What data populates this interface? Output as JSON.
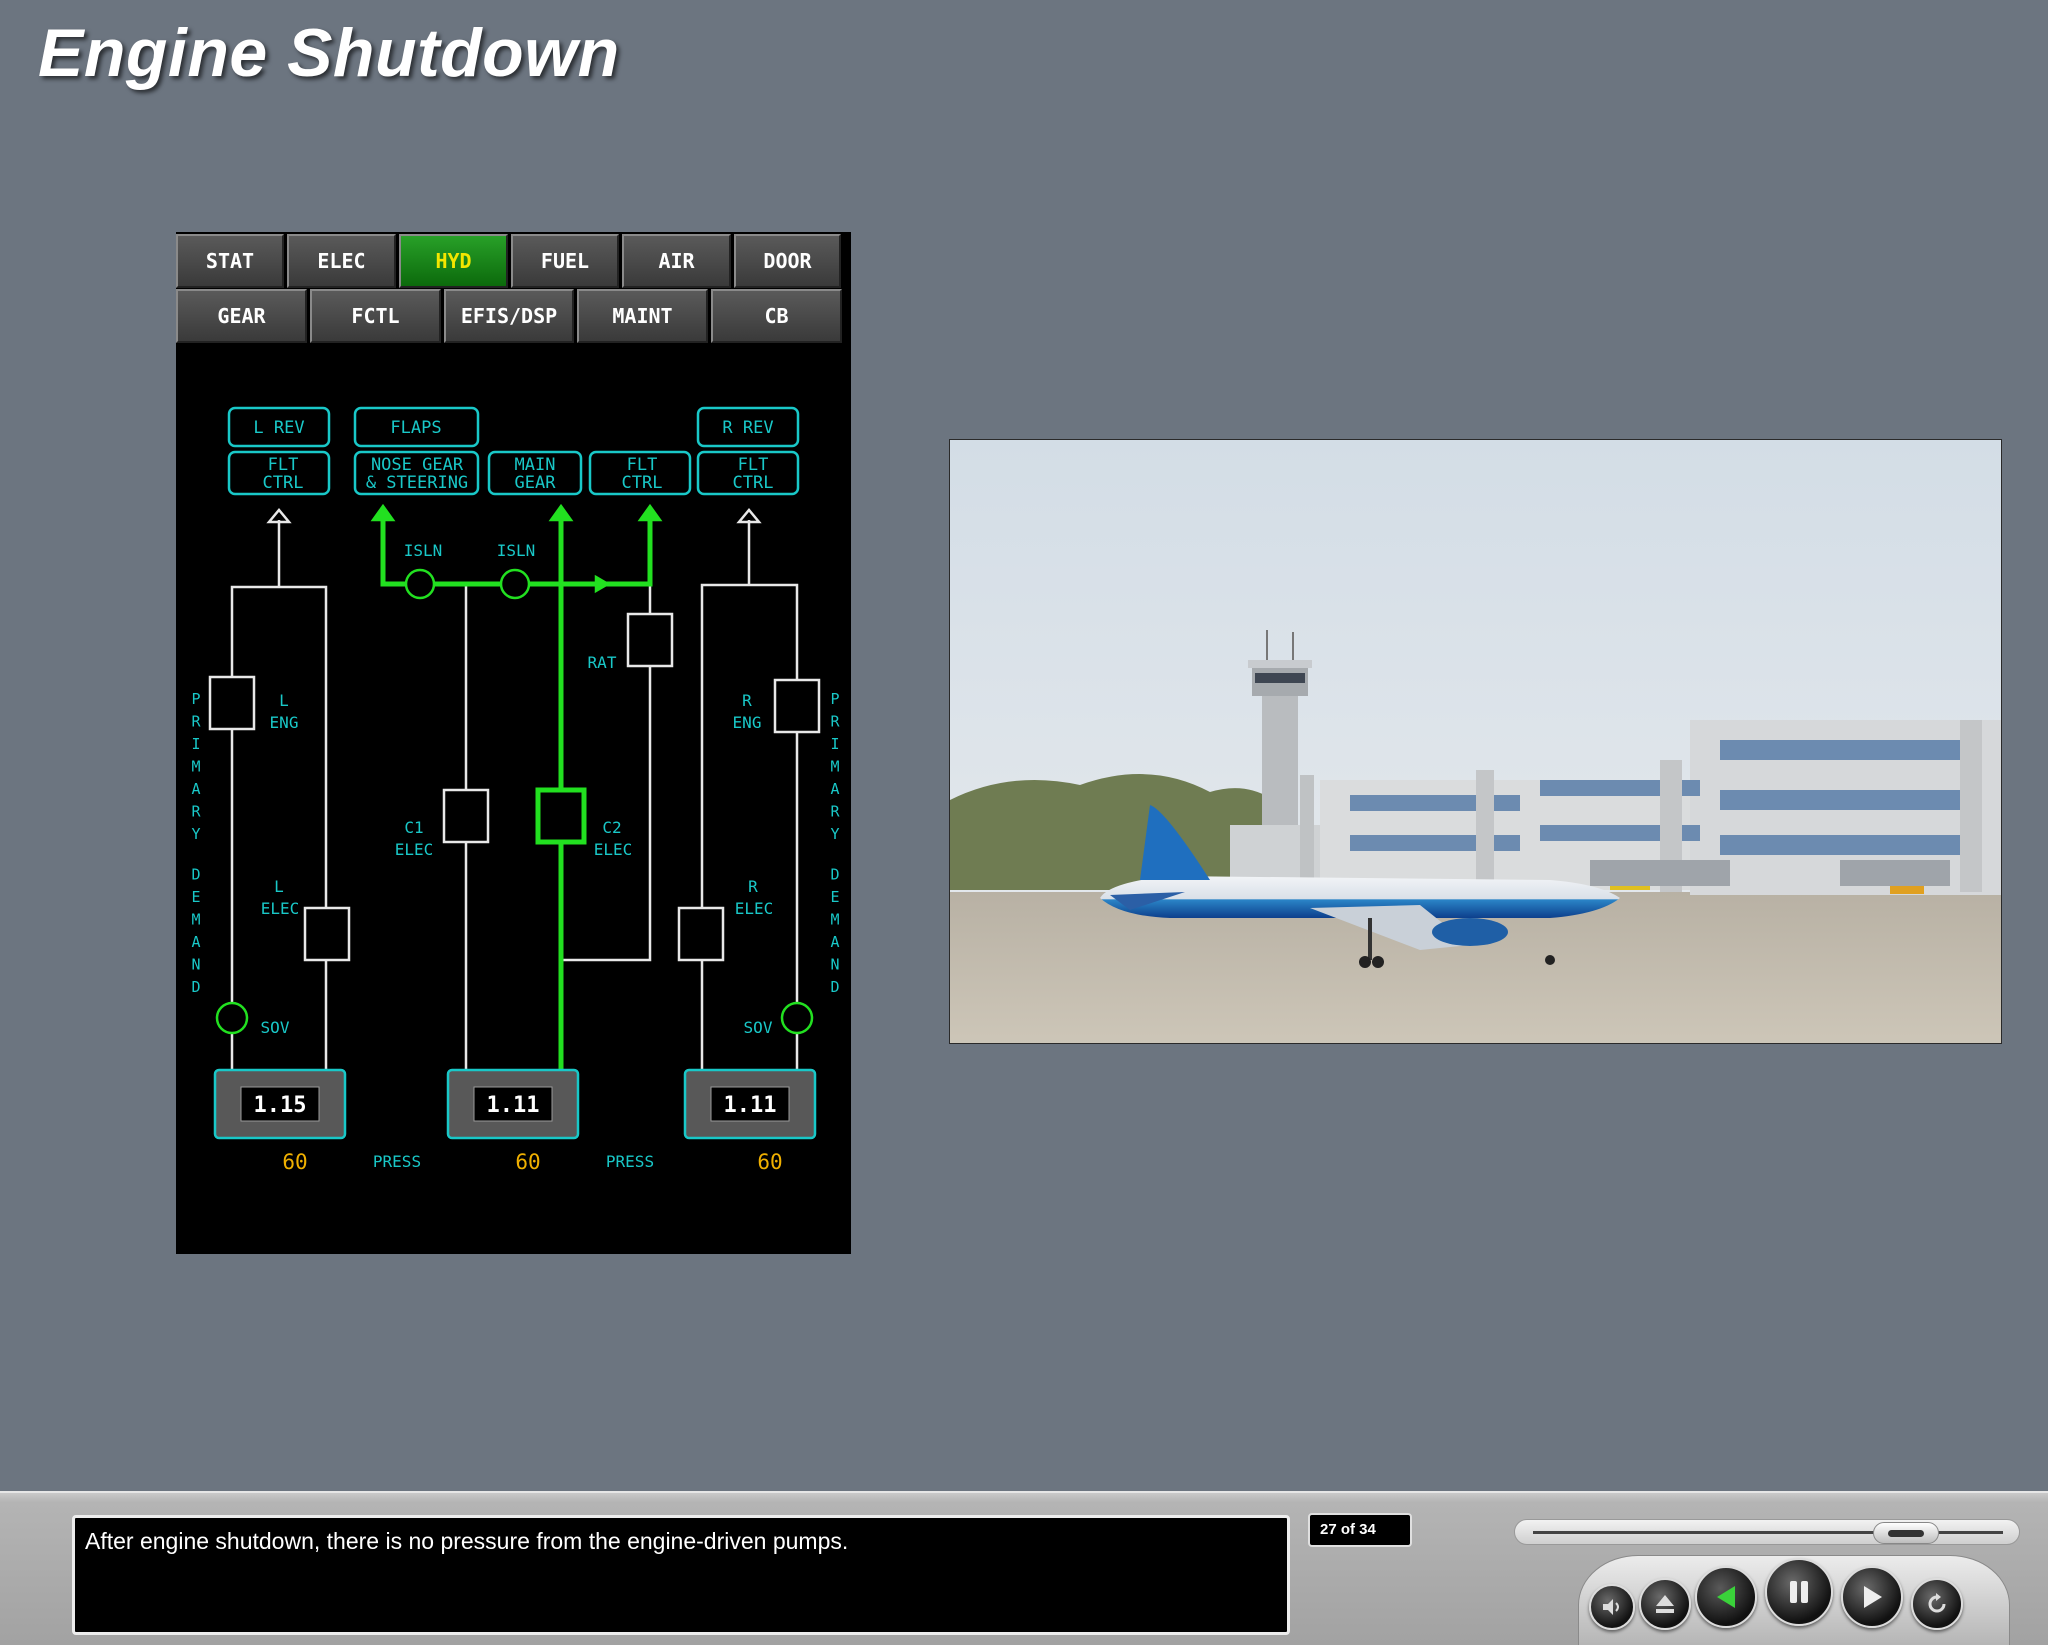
{
  "slide": {
    "title": "Engine Shutdown"
  },
  "synoptic": {
    "tabs_row1": [
      "STAT",
      "ELEC",
      "HYD",
      "FUEL",
      "AIR",
      "DOOR"
    ],
    "tabs_row2": [
      "GEAR",
      "FCTL",
      "EFIS/DSP",
      "MAINT",
      "CB"
    ],
    "active_tab": "HYD",
    "labels": {
      "l_rev": "L REV",
      "flaps": "FLAPS",
      "r_rev": "R REV",
      "flt": "FLT",
      "ctrl": "CTRL",
      "nose_gear": "NOSE GEAR",
      "steering": "& STEERING",
      "main": "MAIN",
      "gear": "GEAR",
      "isln": "ISLN",
      "rat": "RAT",
      "l": "L",
      "r": "R",
      "eng": "ENG",
      "elec": "ELEC",
      "c1": "C1",
      "c2": "C2",
      "sov": "SOV",
      "press": "PRESS",
      "primary": "PRIMARY",
      "demand": "DEMAND"
    },
    "systems": [
      {
        "name": "L",
        "quantity": "1.15",
        "pressure": "60"
      },
      {
        "name": "C",
        "quantity": "1.11",
        "pressure": "60"
      },
      {
        "name": "R",
        "quantity": "1.11",
        "pressure": "60"
      }
    ],
    "colors": {
      "cyan": "#19c8c8",
      "green": "#22e020",
      "amber": "#f0b000",
      "white": "#e8e8e8"
    }
  },
  "caption": {
    "text": "After engine shutdown, there is no pressure from the engine-driven pumps."
  },
  "player": {
    "page_counter": "27 of 34",
    "progress_fraction": 0.794,
    "controls": [
      "volume-icon",
      "eject-icon",
      "back-icon",
      "pause-icon",
      "forward-icon",
      "replay-icon"
    ]
  }
}
